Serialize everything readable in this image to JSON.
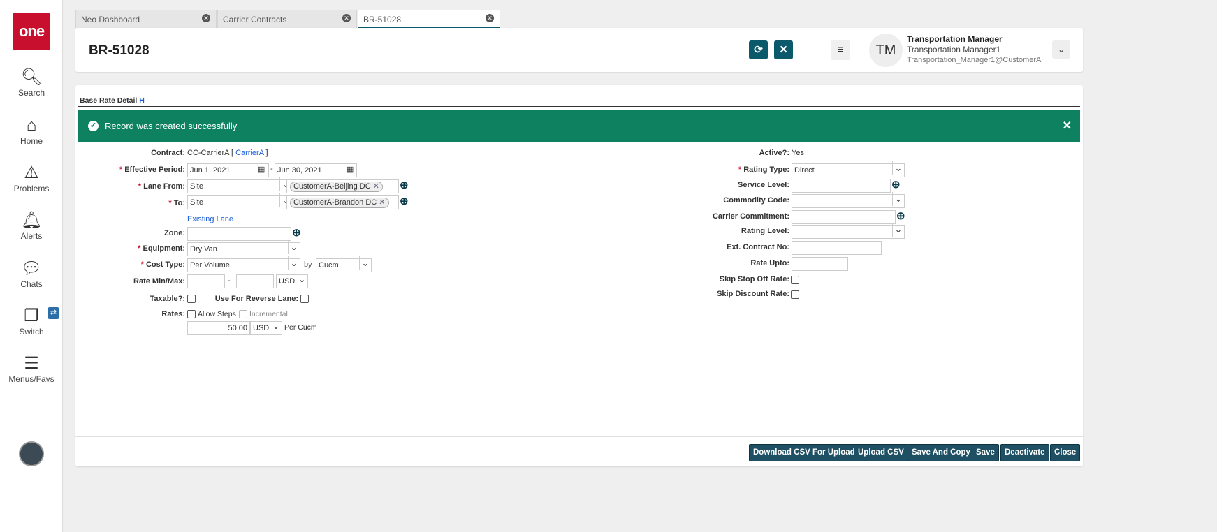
{
  "sidebar": {
    "logo": "one",
    "items": [
      {
        "label": "Search"
      },
      {
        "label": "Home"
      },
      {
        "label": "Problems"
      },
      {
        "label": "Alerts"
      },
      {
        "label": "Chats"
      },
      {
        "label": "Switch"
      },
      {
        "label": "Menus/Favs"
      }
    ]
  },
  "tabs": [
    {
      "label": "Neo Dashboard"
    },
    {
      "label": "Carrier Contracts"
    },
    {
      "label": "BR-51028"
    }
  ],
  "header": {
    "title": "BR-51028",
    "user": {
      "initials": "TM",
      "role": "Transportation Manager",
      "name": "Transportation Manager1",
      "email": "Transportation_Manager1@CustomerA"
    }
  },
  "section": {
    "title": "Base Rate Detail",
    "h_link": "H"
  },
  "banner": {
    "message": "Record was created successfully",
    "color": "#0e8260"
  },
  "form": {
    "contract_label": "Contract:",
    "contract_value": "CC-CarrierA [",
    "contract_link": "CarrierA",
    "contract_end": "]",
    "effective_label": "Effective Period:",
    "effective_from": "Jun 1, 2021",
    "effective_to": "Jun 30, 2021",
    "dash": "-",
    "lane_from_label": "Lane From:",
    "lane_from_type": "Site",
    "lane_from_chip": "CustomerA-Beijing DC",
    "to_label": "To:",
    "to_type": "Site",
    "to_chip": "CustomerA-Brandon DC",
    "existing_lane": "Existing Lane",
    "zone_label": "Zone:",
    "zone_value": "",
    "equipment_label": "Equipment:",
    "equipment_value": "Dry Van",
    "cost_type_label": "Cost Type:",
    "cost_type_value": "Per Volume",
    "by": "by",
    "cost_unit": "Cucm",
    "rate_minmax_label": "Rate Min/Max:",
    "rate_currency": "USD",
    "taxable_label": "Taxable?:",
    "reverse_label": "Use For Reverse Lane:",
    "rates_label": "Rates:",
    "allow_steps": "Allow Steps",
    "incremental": "Incremental",
    "rate_value": "50.00",
    "rate_value_currency": "USD",
    "per_unit": "Per Cucm",
    "active_label": "Active?:",
    "active_value": "Yes",
    "rating_type_label": "Rating Type:",
    "rating_type_value": "Direct",
    "service_level_label": "Service Level:",
    "commodity_label": "Commodity Code:",
    "carrier_commitment_label": "Carrier Commitment:",
    "rating_level_label": "Rating Level:",
    "ext_contract_label": "Ext. Contract No:",
    "rate_upto_label": "Rate Upto:",
    "skip_stop_label": "Skip Stop Off Rate:",
    "skip_discount_label": "Skip Discount Rate:"
  },
  "footer": {
    "buttons": [
      "Download CSV For Upload",
      "Upload CSV",
      "Save And Copy",
      "Save",
      "Deactivate",
      "Close"
    ]
  }
}
